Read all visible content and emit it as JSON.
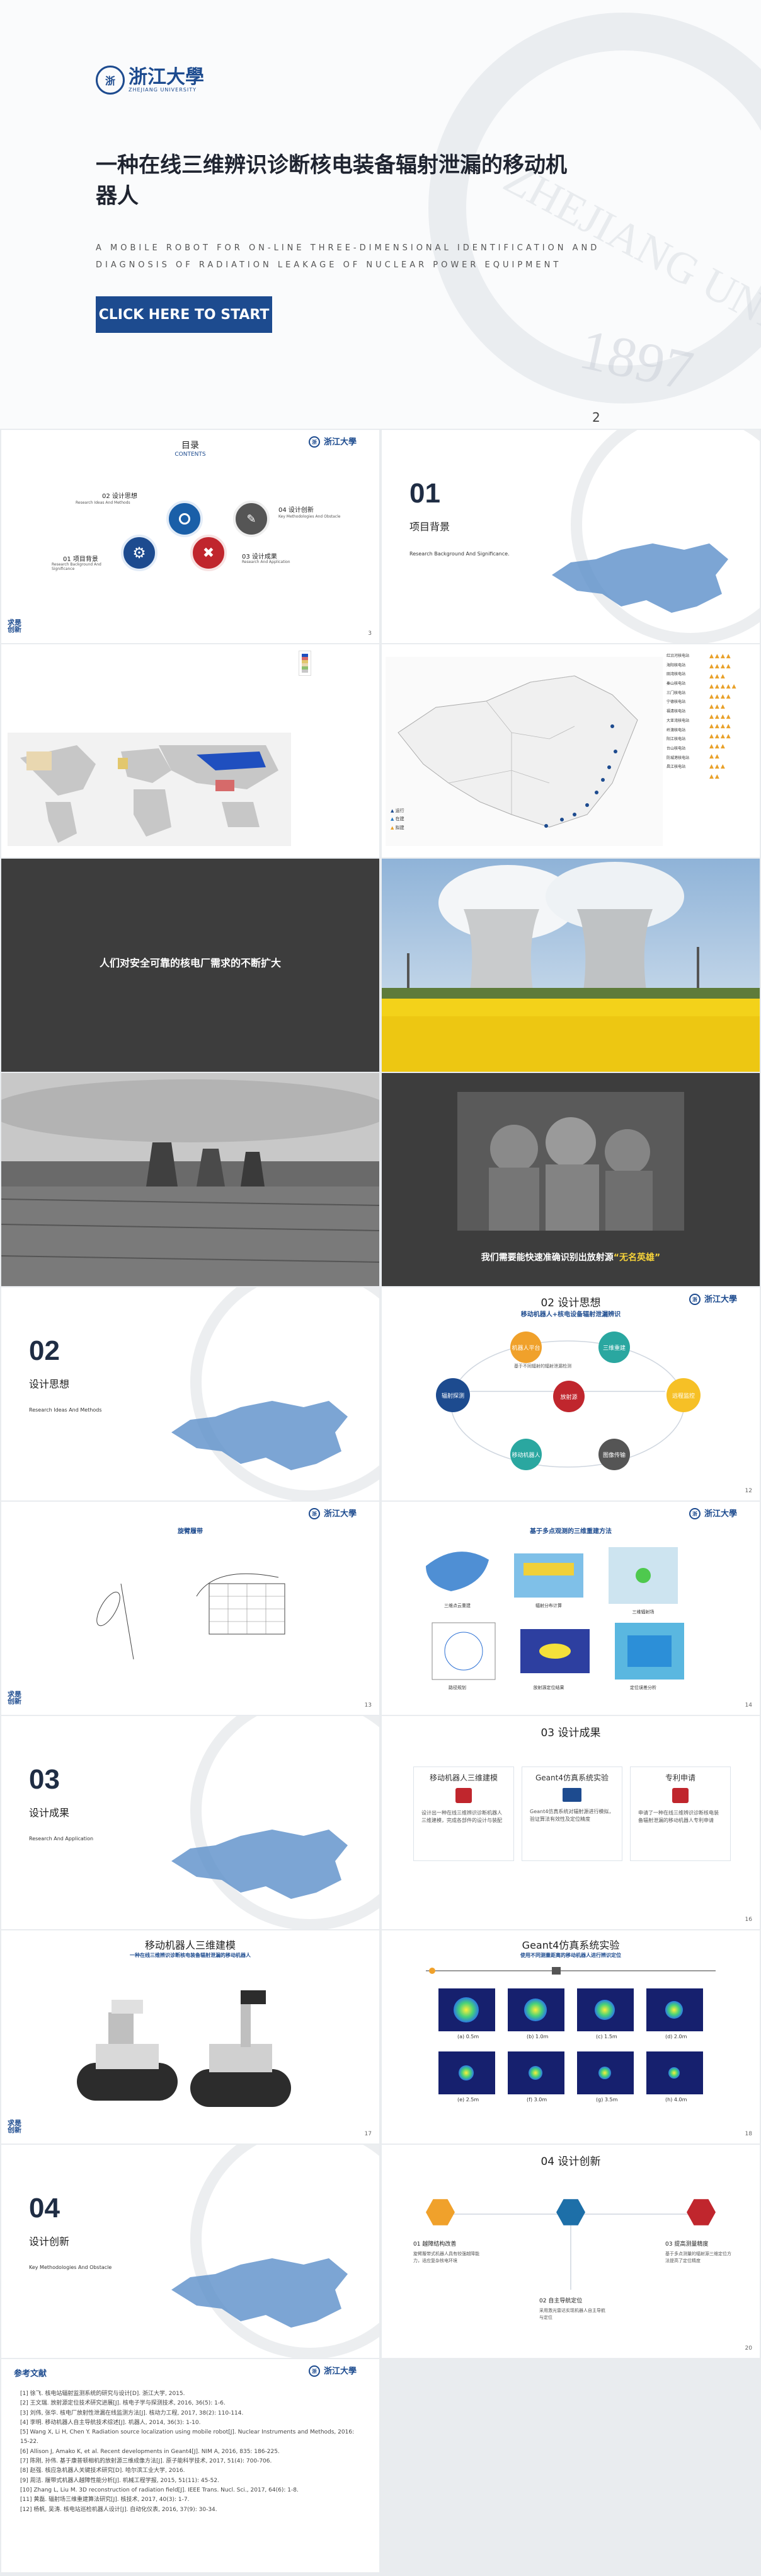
{
  "cover": {
    "title": "一种在线三维辨识诊断核电装备辐射泄漏的移动机器人",
    "subtitle_en": "A MOBILE ROBOT FOR ON-LINE THREE-DIMENSIONAL IDENTIFICATION AND DIAGNOSIS OF RADIATION LEAKAGE OF NUCLEAR POWER EQUIPMENT",
    "cta": "CLICK HERE TO START",
    "page": "2",
    "logo_text": "浙江大學",
    "logo_sub": "ZHEJIANG UNIVERSITY",
    "watermark_year": "1897",
    "watermark_text": "ZHEJIANG UNIVERSITY"
  },
  "toc": {
    "title": "目录",
    "title_en": "CONTENTS",
    "items": [
      {
        "label": "02 设计思想",
        "sub": "Research Ideas And Methods",
        "color": "#1a5fa8"
      },
      {
        "label": "04 设计创新",
        "sub": "Key Methodologies And Obstacle",
        "color": "#555555"
      },
      {
        "label": "01 项目背景",
        "sub": "Research Background And Significance",
        "color": "#1d4b8f"
      },
      {
        "label": "03 设计成果",
        "sub": "Research And Application",
        "color": "#c0262d"
      }
    ],
    "page": "3"
  },
  "sections": [
    {
      "no": "01",
      "title": "项目背景",
      "sub": "Research Background And Significance."
    },
    {
      "no": "02",
      "title": "设计思想",
      "sub": "Research Ideas And Methods"
    },
    {
      "no": "03",
      "title": "设计成果",
      "sub": "Research And Application"
    },
    {
      "no": "04",
      "title": "设计创新",
      "sub": "Key Methodologies And Obstacle"
    }
  ],
  "statements": {
    "demand": "人们对安全可靠的核电厂需求的不断扩大",
    "heroes_pre": "我们需要能快速准确识别出放射源",
    "heroes_quote": "“无名英雄”"
  },
  "china_map": {
    "legend": [
      "运行",
      "在建",
      "拟建"
    ],
    "labels": [
      "红沿河核电站",
      "海阳核电站",
      "田湾核电站",
      "秦山核电站",
      "三门核电站",
      "宁德核电站",
      "福清核电站",
      "大亚湾核电站",
      "岭澳核电站",
      "阳江核电站",
      "台山核电站",
      "防城港核电站",
      "昌江核电站"
    ]
  },
  "design_idea": {
    "title": "02 设计思想",
    "subtitle": "移动机器人+核电设备辐射泄漏辨识",
    "note": "基于不同辐射的辐射泄漏检测",
    "nodes": [
      {
        "label": "机器人平台",
        "color": "#f0a12b"
      },
      {
        "label": "三维重建",
        "color": "#2aa7a0"
      },
      {
        "label": "放射源",
        "color": "#c0262d"
      },
      {
        "label": "辐射探测",
        "color": "#1d4b8f"
      },
      {
        "label": "远程监控",
        "color": "#f6c026"
      },
      {
        "label": "移动机器人",
        "color": "#2aa7a0"
      },
      {
        "label": "图像传输",
        "color": "#555555"
      }
    ],
    "page": "12"
  },
  "chassis": {
    "title": "旋臂履带",
    "page": "13"
  },
  "algo": {
    "title": "基于多点观测的三维重建方法",
    "captions": [
      "三维点云重建",
      "辐射分布计算",
      "三维辐射场",
      "路径规划",
      "放射源定位结果",
      "定位误差分析"
    ],
    "page": "14"
  },
  "results": {
    "title": "03 设计成果",
    "cards": [
      {
        "head": "移动机器人三维建模",
        "text": "设计出一种在线三维辨识诊断机器人三维建模，完成各部件的设计与装配",
        "icon": "doc"
      },
      {
        "head": "Geant4仿真系统实验",
        "text": "Geant4仿真系统对辐射源进行模拟，验证算法有效性及定位精度",
        "icon": "pc"
      },
      {
        "head": "专利申请",
        "text": "申请了一种在线三维辨识诊断核电装备辐射泄漏的移动机器人专利申请",
        "icon": "patent"
      }
    ],
    "page": "16"
  },
  "robot_model": {
    "title": "移动机器人三维建模",
    "subtitle": "一种在线三维辨识诊断核电装备辐射泄漏的移动机器人",
    "page": "17"
  },
  "geant4": {
    "title": "Geant4仿真系统实验",
    "subtitle": "使用不同测量距离的移动机器人进行辨识定位",
    "captions": [
      "(a) 0.5m",
      "(b) 1.0m",
      "(c) 1.5m",
      "(d) 2.0m",
      "(e) 2.5m",
      "(f) 3.0m",
      "(g) 3.5m",
      "(h) 4.0m"
    ],
    "page": "18"
  },
  "innovation": {
    "title": "04 设计创新",
    "items": [
      {
        "label": "01 越障结构改善",
        "text": "旋臂履带式机器人具有较强越障能力，适应复杂核电环境",
        "color": "#f0a12b"
      },
      {
        "label": "02 自主导航定位",
        "text": "采用激光雷达实现机器人自主导航与定位",
        "color": "#1d6fa8"
      },
      {
        "label": "03 提高测量精度",
        "text": "基于多点测量的辐射源三维定位方法提高了定位精度",
        "color": "#c0262d"
      }
    ],
    "page": "20"
  },
  "references": {
    "title": "参考文献",
    "lines": [
      "[1] 徐飞. 核电站辐射监测系统的研究与设计[D]. 浙江大学, 2015.",
      "[2] 王文瑞. 放射源定位技术研究进展[J]. 核电子学与探测技术, 2016, 36(5): 1-6.",
      "[3] 刘伟, 张华. 核电厂放射性泄漏在线监测方法[J]. 核动力工程, 2017, 38(2): 110-114.",
      "[4] 李明. 移动机器人自主导航技术综述[J]. 机器人, 2014, 36(3): 1-10.",
      "[5] Wang X, Li H, Chen Y. Radiation source localization using mobile robot[J]. Nuclear Instruments and Methods, 2016: 15-22.",
      "[6] Allison J, Amako K, et al. Recent developments in Geant4[J]. NIM A, 2016, 835: 186-225.",
      "[7] 陈刚, 孙伟. 基于康普顿相机的放射源三维成像方法[J]. 原子能科学技术, 2017, 51(4): 700-706.",
      "[8] 赵强. 核应急机器人关键技术研究[D]. 哈尔滨工业大学, 2016.",
      "[9] 周洁. 履带式机器人越障性能分析[J]. 机械工程学报, 2015, 51(11): 45-52.",
      "[10] Zhang L, Liu M. 3D reconstruction of radiation field[J]. IEEE Trans. Nucl. Sci., 2017, 64(6): 1-8.",
      "[11] 黄磊. 辐射场三维重建算法研究[J]. 核技术, 2017, 40(3): 1-7.",
      "[12] 杨帆, 吴涛. 核电站巡检机器人设计[J]. 自动化仪表, 2016, 37(9): 30-34."
    ]
  }
}
